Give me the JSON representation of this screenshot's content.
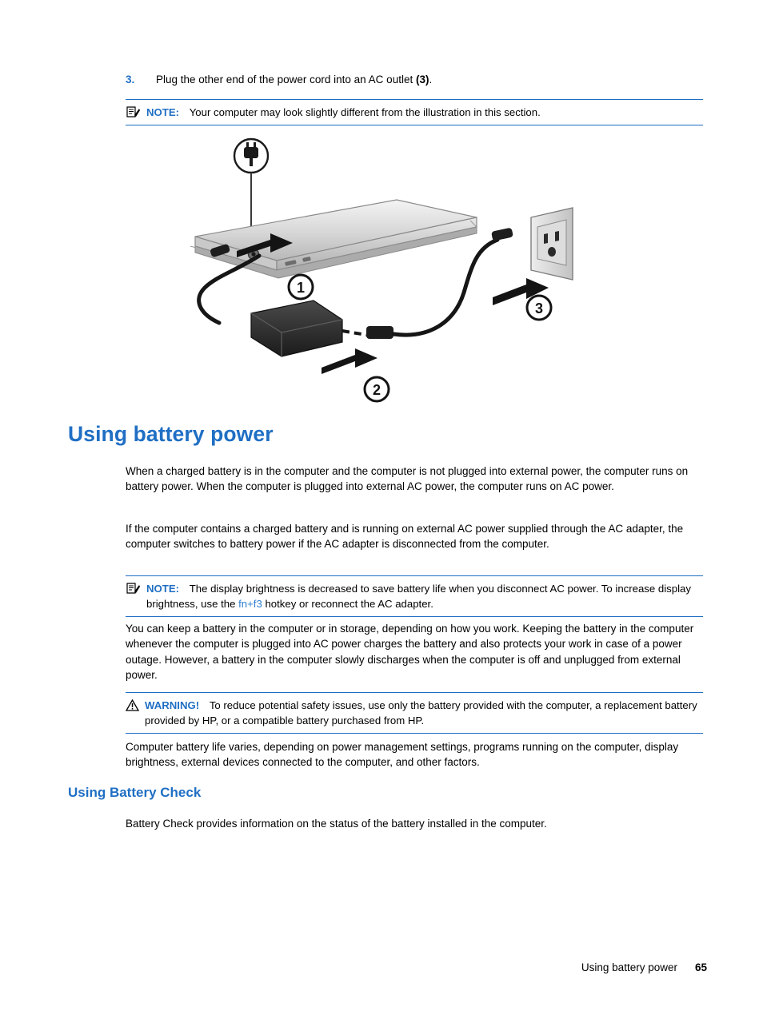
{
  "step": {
    "number": "3.",
    "text_before": "Plug the other end of the power cord into an AC outlet ",
    "text_bold": "(3)",
    "text_after": "."
  },
  "note_top": {
    "label": "NOTE:",
    "text": "Your computer may look slightly different from the illustration in this section."
  },
  "figure": {
    "alt": "Illustration of a notebook computer connected by AC adapter to a wall outlet",
    "callout_1": "1",
    "callout_2": "2",
    "callout_3": "3"
  },
  "heading": {
    "title": "Using battery power",
    "subtitle": "Using Battery Check"
  },
  "paragraphs": {
    "p1": "When a charged battery is in the computer and the computer is not plugged into external power, the computer runs on battery power. When the computer is plugged into external AC power, the computer runs on AC power.",
    "p2": "If the computer contains a charged battery and is running on external AC power supplied through the AC adapter, the computer switches to battery power if the AC adapter is disconnected from the computer.",
    "p3": "You can keep a battery in the computer or in storage, depending on how you work. Keeping the battery in the computer whenever the computer is plugged into AC power charges the battery and also protects your work in case of a power outage. However, a battery in the computer slowly discharges when the computer is off and unplugged from external power.",
    "p4": "Computer battery life varies, depending on power management settings, programs running on the computer, display brightness, external devices connected to the computer, and other factors.",
    "p5": "Battery Check provides information on the status of the battery installed in the computer."
  },
  "note_mid": {
    "label": "NOTE:",
    "text_before": "The display brightness is decreased to save battery life when you disconnect AC power. To increase display brightness, use the ",
    "link": "fn+f3",
    "text_after": " hotkey or reconnect the AC adapter."
  },
  "warning": {
    "label": "WARNING!",
    "text": "To reduce potential safety issues, use only the battery provided with the computer, a replacement battery provided by HP, or a compatible battery purchased from HP."
  },
  "footer": {
    "text": "Using battery power",
    "page": "65"
  },
  "colors": {
    "accent": "#1f6fc4",
    "link": "#2f7fd0"
  }
}
